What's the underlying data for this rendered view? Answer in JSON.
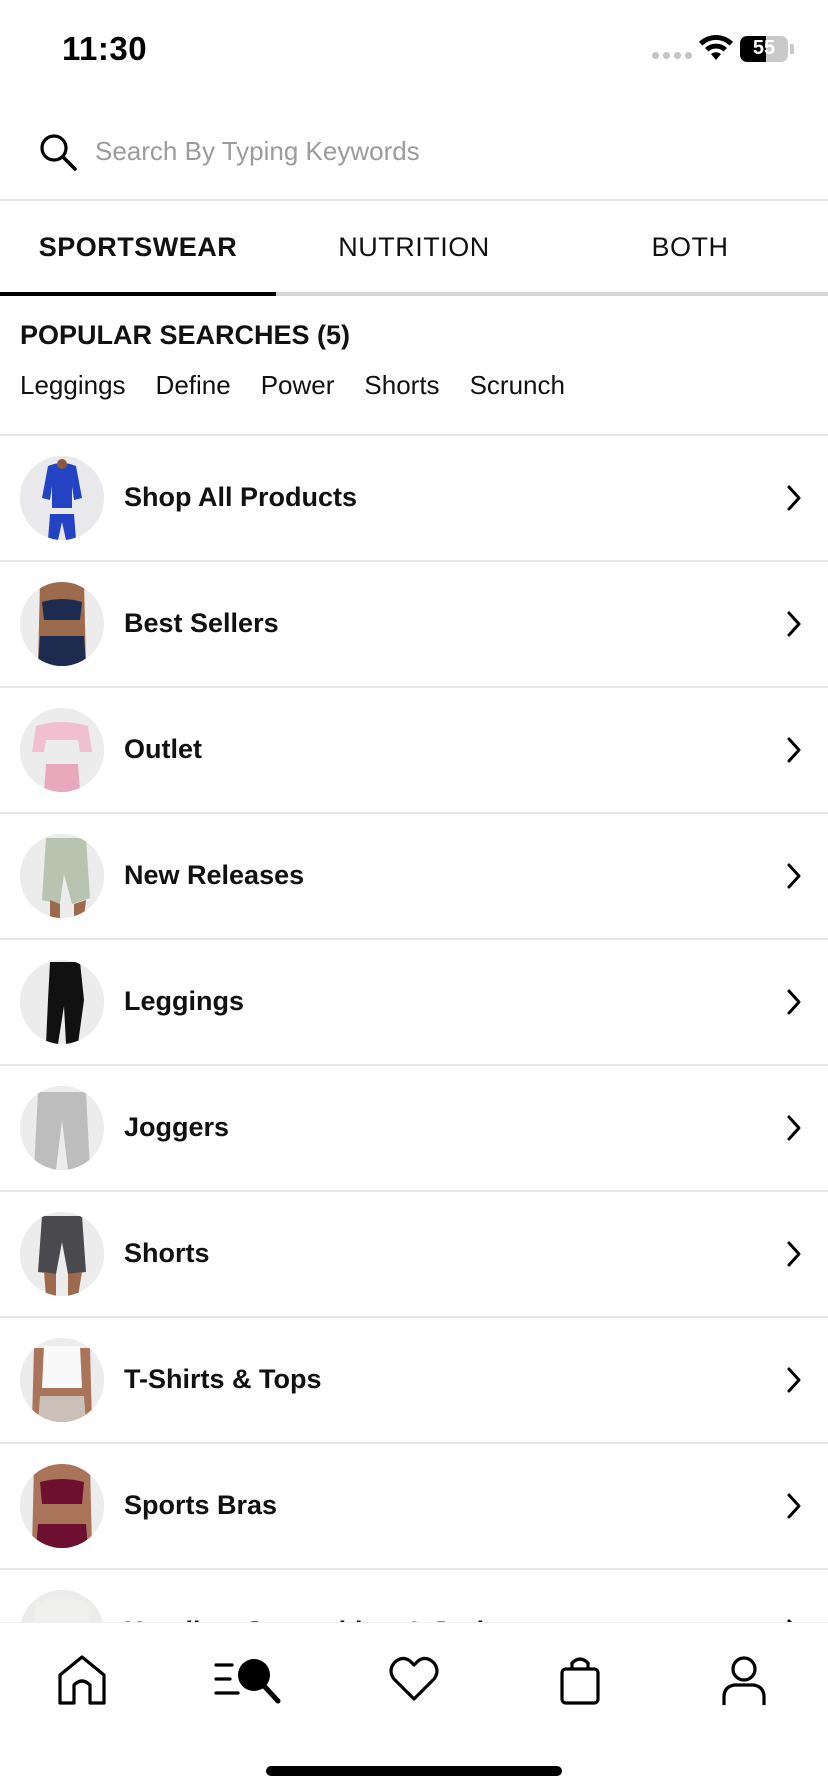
{
  "status_bar": {
    "time": "11:30",
    "battery_level": "55",
    "battery_percent": 55
  },
  "search": {
    "placeholder": "Search By Typing Keywords",
    "icon": "search-icon"
  },
  "tabs": [
    {
      "label": "SPORTSWEAR",
      "active": true
    },
    {
      "label": "NUTRITION",
      "active": false
    },
    {
      "label": "BOTH",
      "active": false
    }
  ],
  "popular_searches": {
    "title": "POPULAR SEARCHES (5)",
    "items": [
      "Leggings",
      "Define",
      "Power",
      "Shorts",
      "Scrunch"
    ]
  },
  "categories": [
    {
      "label": "Shop All Products",
      "thumb_color": "#2343c4"
    },
    {
      "label": "Best Sellers",
      "thumb_color": "#1d2b4f"
    },
    {
      "label": "Outlet",
      "thumb_color": "#f0bfd0"
    },
    {
      "label": "New Releases",
      "thumb_color": "#b8c4b0"
    },
    {
      "label": "Leggings",
      "thumb_color": "#111111"
    },
    {
      "label": "Joggers",
      "thumb_color": "#bdbdbd"
    },
    {
      "label": "Shorts",
      "thumb_color": "#4a4a4e"
    },
    {
      "label": "T-Shirts & Tops",
      "thumb_color": "#f2f2f2"
    },
    {
      "label": "Sports Bras",
      "thumb_color": "#6d1030"
    },
    {
      "label": "Hoodies, Sweatshirts & Jackets",
      "thumb_color": "#f0f0ee"
    }
  ],
  "bottom_nav": [
    {
      "icon": "home-icon",
      "active": false
    },
    {
      "icon": "search-menu-icon",
      "active": true
    },
    {
      "icon": "heart-icon",
      "active": false
    },
    {
      "icon": "bag-icon",
      "active": false
    },
    {
      "icon": "profile-icon",
      "active": false
    }
  ]
}
